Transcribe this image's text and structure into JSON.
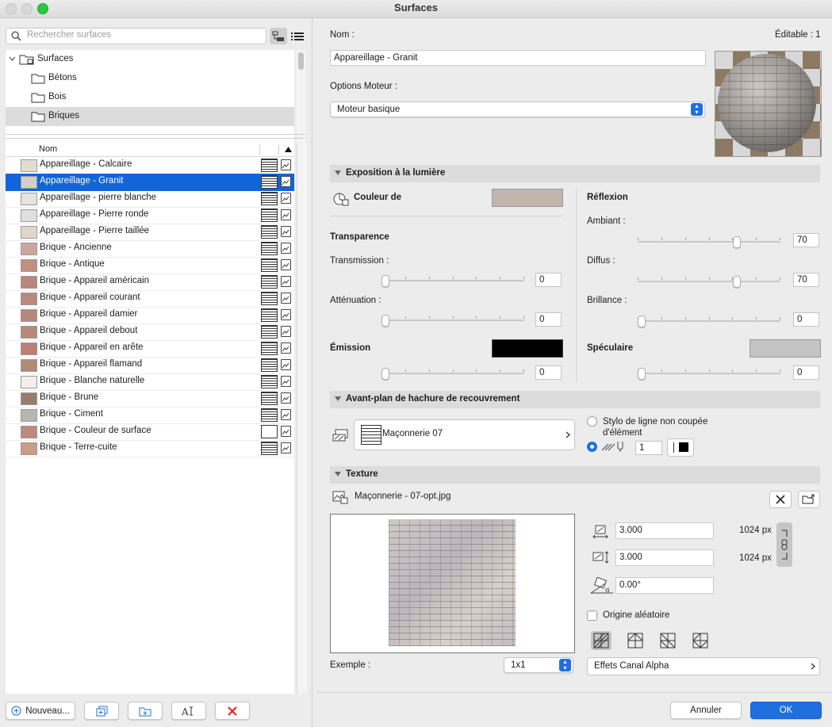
{
  "window": {
    "title": "Surfaces"
  },
  "search": {
    "placeholder": "Rechercher surfaces"
  },
  "tree": {
    "root": "Surfaces",
    "folders": [
      "Bétons",
      "Bois",
      "Briques"
    ],
    "selected_folder": "Briques"
  },
  "list": {
    "column_name": "Nom",
    "items": [
      {
        "name": "Appareillage - Calcaire",
        "color": "#e4dcd2"
      },
      {
        "name": "Appareillage - Granit",
        "color": "#d6cec6",
        "selected": true
      },
      {
        "name": "Appareillage - pierre blanche",
        "color": "#e6e2de"
      },
      {
        "name": "Appareillage - Pierre ronde",
        "color": "#dedee4"
      },
      {
        "name": "Appareillage - Pierre taillée",
        "color": "#e0d6c8"
      },
      {
        "name": "Brique - Ancienne",
        "color": "#c8a89c"
      },
      {
        "name": "Brique - Antique",
        "color": "#bf8f80"
      },
      {
        "name": "Brique - Appareil américain",
        "color": "#b88778"
      },
      {
        "name": "Brique - Appareil courant",
        "color": "#b98a7c"
      },
      {
        "name": "Brique - Appareil damier",
        "color": "#b6887a"
      },
      {
        "name": "Brique - Appareil debout",
        "color": "#b7897a"
      },
      {
        "name": "Brique - Appareil en arête",
        "color": "#bd7e76"
      },
      {
        "name": "Brique - Appareil flamand",
        "color": "#b48878"
      },
      {
        "name": "Brique - Blanche naturelle",
        "color": "#f1eeec"
      },
      {
        "name": "Brique - Brune",
        "color": "#9a7a6c"
      },
      {
        "name": "Brique - Ciment",
        "color": "#b8b6ae"
      },
      {
        "name": "Brique - Couleur de surface",
        "color": "#be8a7e"
      },
      {
        "name": "Brique - Terre-cuite",
        "color": "#cc9c88"
      }
    ]
  },
  "bottom_buttons": {
    "new_label": "Nouveau..."
  },
  "general": {
    "name_label": "Nom :",
    "editable_label": "Éditable : 1",
    "name_value": "Appareillage - Granit",
    "engine_label": "Options Moteur :",
    "engine_value": "Moteur basique"
  },
  "exposure": {
    "title": "Exposition à la lumière",
    "color_label": "Couleur de",
    "surface_color": "#c0b6ae",
    "transparency": {
      "title": "Transparence",
      "transmission_label": "Transmission :",
      "transmission_value": "0",
      "attenuation_label": "Atténuation :",
      "attenuation_value": "0"
    },
    "emission": {
      "title": "Émission",
      "color": "#000000",
      "value": "0"
    },
    "reflection": {
      "title": "Réflexion",
      "ambient_label": "Ambiant :",
      "ambient_value": "70",
      "diffuse_label": "Diffus :",
      "diffuse_value": "70",
      "shininess_label": "Brillance :",
      "shininess_value": "0"
    },
    "specular": {
      "title": "Spéculaire",
      "color": "#c4c4c4",
      "value": "0"
    }
  },
  "hatch": {
    "title": "Avant-plan de hachure de recouvrement",
    "pattern": "Maçonnerie 07",
    "option_uncut_line": "Stylo de ligne non coupée d'élément",
    "pen_value": "1"
  },
  "texture": {
    "title": "Texture",
    "file": "Maçonnerie - 07-opt.jpg",
    "width_value": "3.000",
    "width_px": "1024 px",
    "height_value": "3.000",
    "height_px": "1024 px",
    "angle_value": "0.00°",
    "random_origin_label": "Origine aléatoire",
    "example_label": "Exemple :",
    "example_value": "1x1",
    "alpha_label": "Effets Canal Alpha"
  },
  "dialog": {
    "cancel_label": "Annuler",
    "ok_label": "OK"
  }
}
